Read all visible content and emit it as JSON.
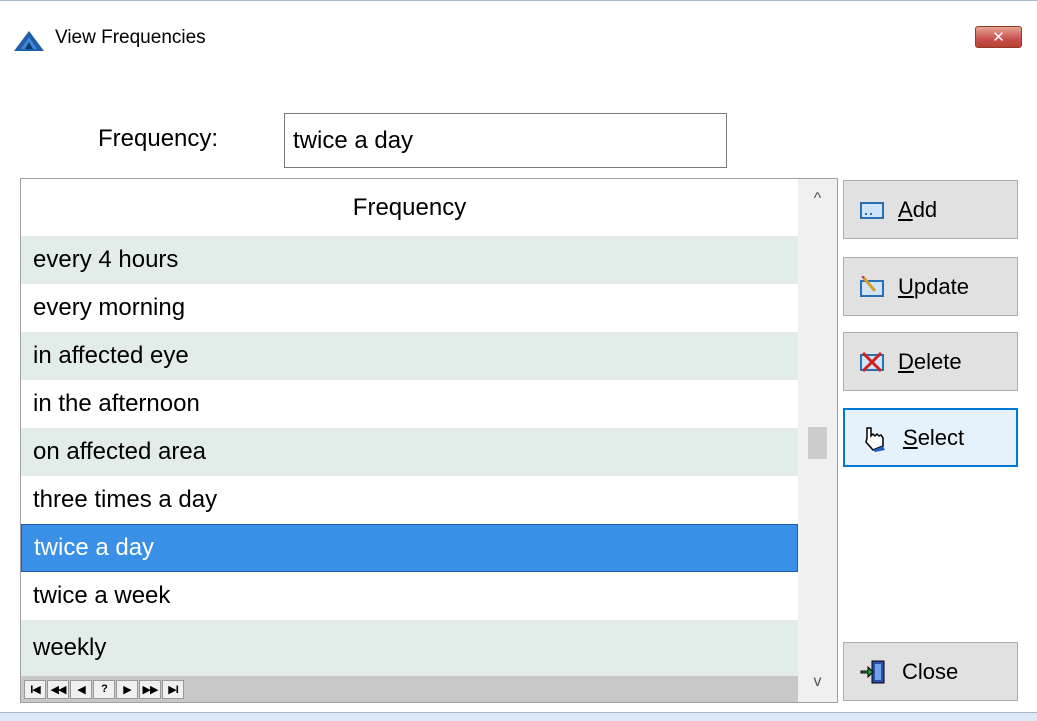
{
  "window": {
    "title": "View Frequencies",
    "close_glyph": "✕"
  },
  "filter": {
    "label": "Frequency:",
    "value": "twice a day"
  },
  "grid": {
    "column_header": "Frequency",
    "rows": [
      {
        "label": "every 4 hours",
        "selected": false
      },
      {
        "label": "every morning",
        "selected": false
      },
      {
        "label": "in affected eye",
        "selected": false
      },
      {
        "label": "in the afternoon",
        "selected": false
      },
      {
        "label": "on affected area",
        "selected": false
      },
      {
        "label": "three times a day",
        "selected": false
      },
      {
        "label": "twice a day",
        "selected": true
      },
      {
        "label": "twice a week",
        "selected": false
      },
      {
        "label": "weekly",
        "selected": false
      }
    ],
    "nav_buttons": [
      {
        "name": "first-record",
        "glyph": "I◀"
      },
      {
        "name": "prev-page",
        "glyph": "◀◀"
      },
      {
        "name": "prev-record",
        "glyph": "◀"
      },
      {
        "name": "find",
        "glyph": "?"
      },
      {
        "name": "next-record",
        "glyph": "▶"
      },
      {
        "name": "next-page",
        "glyph": "▶▶"
      },
      {
        "name": "last-record",
        "glyph": "▶I"
      }
    ],
    "scroll_up_glyph": "^",
    "scroll_down_glyph": "v"
  },
  "buttons": {
    "add": {
      "accel": "A",
      "rest": "dd",
      "icon": "add-icon"
    },
    "update": {
      "accel": "U",
      "rest": "pdate",
      "icon": "update-icon"
    },
    "delete": {
      "accel": "D",
      "rest": "elete",
      "icon": "delete-icon"
    },
    "select": {
      "accel": "S",
      "rest": "elect",
      "icon": "hand-pointer-icon"
    },
    "close": {
      "label": "Close",
      "icon": "exit-door-icon"
    }
  },
  "colors": {
    "selection": "#3a8fe6",
    "alt_row": "#e2edea",
    "focus_border": "#0078d7"
  }
}
